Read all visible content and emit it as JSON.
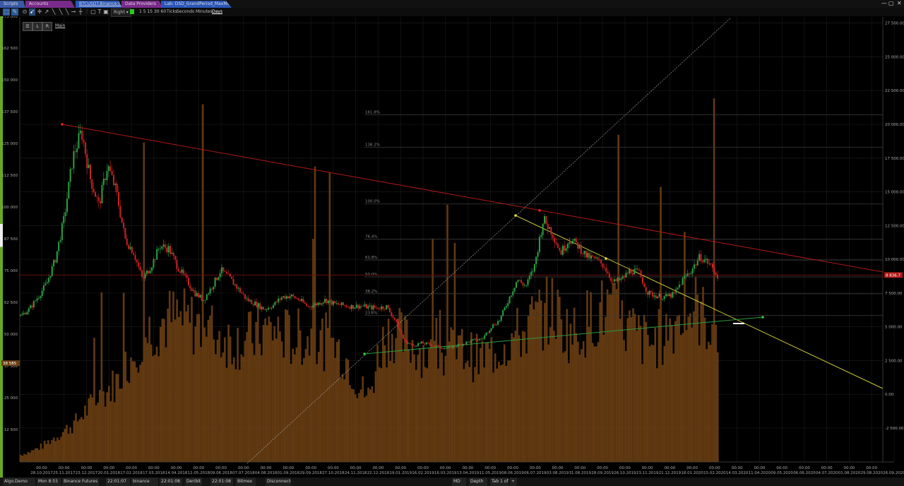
{
  "tabs": [
    {
      "label": "Scripts",
      "color": "#3a5aa8"
    },
    {
      "label": "Accounts",
      "color": "#8a2a9a"
    },
    {
      "label": "BTCUSDT.Binance:binance.1D",
      "color": "#2a56b8"
    },
    {
      "label": "Data Providers",
      "color": "#8a2a9a"
    },
    {
      "label": "Lab: DSD_GrandPeriod_MaxMin",
      "color": "#2a56b8"
    }
  ],
  "window_controls": {
    "close": "✕",
    "min": "—",
    "max": "▢",
    "x": "✕"
  },
  "toolbar": {
    "align_value": "Right",
    "periods": "1 5 15 30 60",
    "ticks": "Ticks",
    "seconds": "Seconds",
    "minutes": "Minutes",
    "days": "Days",
    "mode_buttons": [
      "L",
      "R"
    ],
    "main_label": "Main"
  },
  "chart_data": {
    "type": "candlestick",
    "left_axis_ticks": [
      "175 000",
      "162 500",
      "150 000",
      "137 500",
      "125 000",
      "112 500",
      "100 000",
      "87 500",
      "75 000",
      "62 500",
      "50 000",
      "37 500",
      "25 000",
      "12 500"
    ],
    "left_axis_range": [
      0,
      175000
    ],
    "right_axis_ticks": [
      "27 500.00",
      "25 000.00",
      "22 500.00",
      "20 000.00",
      "17 500.00",
      "15 000.00",
      "12 500.00",
      "10 000.00",
      "7 500.00",
      "5 000.00",
      "2 500.00",
      "0.00",
      "-2 500.00"
    ],
    "right_axis_range": [
      -5000,
      27500
    ],
    "price_marker": "8 836.7",
    "volume_marker": "38 585",
    "fib_levels": [
      {
        "label": "161.8%",
        "price": 20700
      },
      {
        "label": "138.2%",
        "price": 18300
      },
      {
        "label": "100.0%",
        "price": 14100
      },
      {
        "label": "76.4%",
        "price": 11500
      },
      {
        "label": "61.8%",
        "price": 9950
      },
      {
        "label": "50.0%",
        "price": 8700
      },
      {
        "label": "38.2%",
        "price": 7450
      },
      {
        "label": "23.6%",
        "price": 5850
      }
    ],
    "x_time_labels": [
      "00:00",
      "00:00",
      "00:00",
      "00:00",
      "00:00",
      "00:00",
      "00:00",
      "00:00",
      "00:00",
      "00:00",
      "00:00",
      "00:00",
      "00:00",
      "00:00",
      "00:00",
      "00:00",
      "00:00",
      "00:00",
      "00:00",
      "00:00",
      "00:00",
      "00:00",
      "00:00",
      "00:00",
      "00:00",
      "00:00",
      "00:00",
      "00:00",
      "00:00",
      "00:00",
      "00:00",
      "00:00",
      "00:00",
      "00:00",
      "00:00",
      "00:00",
      "00:00",
      "00:00"
    ],
    "x_date_labels": [
      "28.10.2017",
      "25.11.2017",
      "23.12.2017",
      "20.01.2018",
      "17.02.2018",
      "17.03.2018",
      "14.04.2018",
      "12.05.2018",
      "09.06.2018",
      "07.07.2018",
      "04.08.2018",
      "01.09.2018",
      "29.09.2018",
      "27.10.2018",
      "24.11.2018",
      "22.12.2018",
      "19.01.2019",
      "16.02.2019",
      "16.03.2019",
      "13.04.2019",
      "11.05.2019",
      "08.06.2019",
      "06.07.2019",
      "03.08.2019",
      "31.08.2019",
      "28.09.2019",
      "26.10.2019",
      "23.11.2019",
      "21.12.2019",
      "18.01.2020",
      "15.02.2020",
      "14.03.2020",
      "11.04.2020",
      "09.05.2020",
      "06.06.2020",
      "04.07.2020",
      "01.08.2020",
      "29.08.2020",
      "26.09.2020"
    ],
    "price_path": [
      5800,
      6300,
      7200,
      8200,
      10000,
      13000,
      17500,
      19500,
      16000,
      14000,
      17000,
      15000,
      11500,
      10500,
      8500,
      9500,
      11000,
      10800,
      9500,
      8500,
      7500,
      7000,
      8000,
      9200,
      8600,
      7800,
      7000,
      6700,
      6300,
      6600,
      7200,
      7300,
      7000,
      6500,
      6700,
      7000,
      6700,
      6600,
      6500,
      6550,
      6450,
      6400,
      6500,
      5500,
      4000,
      3600,
      3800,
      3700,
      3500,
      3400,
      3600,
      3800,
      4000,
      4100,
      5000,
      5500,
      7000,
      8500,
      8000,
      9500,
      13000,
      12000,
      10500,
      11500,
      11000,
      10200,
      10000,
      9500,
      8300,
      8500,
      9200,
      9000,
      7500,
      7300,
      7200,
      7400,
      8500,
      9200,
      10200,
      9700,
      8800
    ],
    "volume_path": [
      2500,
      4000,
      6000,
      9000,
      12000,
      15000,
      20000,
      24000,
      28000,
      32000,
      40000,
      48000,
      52000,
      55000,
      56000,
      55000,
      54000,
      52000,
      50000,
      48000,
      47000,
      48000,
      50000,
      52000,
      50000,
      48000,
      49000,
      48000,
      47000,
      45000,
      40000,
      30000,
      25000,
      45000,
      52000,
      48000,
      46000,
      43000,
      40000,
      42000,
      44000,
      43000,
      40000,
      42000,
      45000,
      48000,
      50000,
      55000,
      58000,
      60000,
      52000,
      50000,
      55000,
      58000,
      60000,
      54000,
      52000,
      48000,
      46000,
      50000,
      55000,
      58000,
      60000,
      55000,
      52000
    ]
  },
  "status_bar": [
    "Algo.Demo",
    "Mon 8:55",
    "Binance Futures",
    "22:01:07",
    "binance",
    "22:01:08",
    "Deribit",
    "22:01:08",
    "Bitmex",
    "Disconnecte",
    "MD",
    "Depth",
    "Tab 1 of",
    "+"
  ],
  "colors": {
    "up": "#2ea043",
    "down": "#cc2222",
    "volume": "#6b3f13",
    "trend_red": "#b01818",
    "trend_yellow": "#c8c83a",
    "trend_green": "#2a9a3a"
  }
}
